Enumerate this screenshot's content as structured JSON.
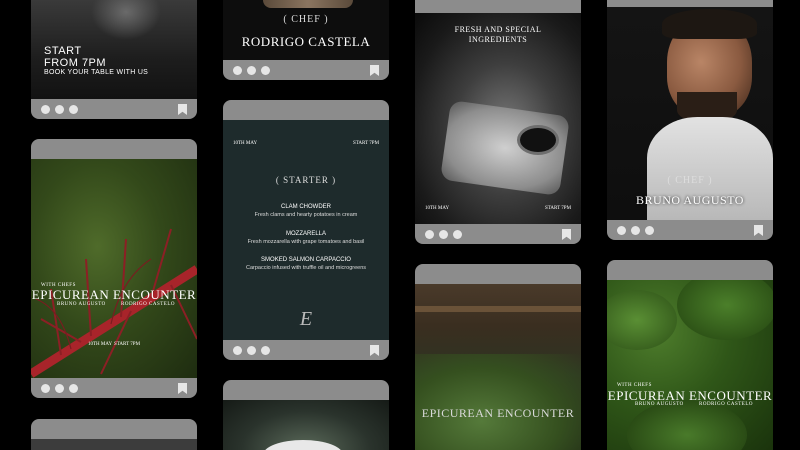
{
  "cards": {
    "c1": {
      "line1": "START",
      "line2": "FROM 7PM",
      "line3": "BOOK YOUR TABLE WITH US"
    },
    "c2": {
      "chef_label": "CHEF",
      "name": "RODRIGO CASTELA"
    },
    "c3": {
      "title_line1": "FRESH AND SPECIAL",
      "title_line2": "INGREDIENTS",
      "date": "10TH MAY",
      "time": "START 7PM"
    },
    "c4": {
      "chef_label": "CHEF",
      "name": "BRUNO AUGUSTO"
    },
    "c5": {
      "with_chefs": "WITH CHEFS",
      "title": "EPICUREAN ENCOUNTER",
      "chef1": "BRUNO AUGUSTO",
      "chef2": "RODRIGO CASTELO",
      "date": "10TH MAY",
      "time": "START 7PM"
    },
    "c6": {
      "date": "10TH MAY",
      "time": "START 7PM",
      "section": "STARTER",
      "menu": [
        {
          "name": "CLAM CHOWDER",
          "desc": "Fresh clams and hearty potatoes in cream"
        },
        {
          "name": "MOZZARELLA",
          "desc": "Fresh mozzarella with grape tomatoes and basil"
        },
        {
          "name": "SMOKED SALMON CARPACCIO",
          "desc": "Carpaccio infused with truffle oil and microgreens"
        }
      ],
      "monogram": "E"
    },
    "c7": {
      "title": "EPICUREAN ENCOUNTER"
    },
    "c8": {
      "with_chefs": "WITH CHEFS",
      "title": "EPICUREAN ENCOUNTER",
      "chef1": "BRUNO AUGUSTO",
      "chef2": "RODRIGO CASTELO"
    }
  },
  "colors": {
    "bar": "#8c8c8c",
    "dot": "#e6e6e6",
    "menu_bg": "#1e2b2c"
  }
}
